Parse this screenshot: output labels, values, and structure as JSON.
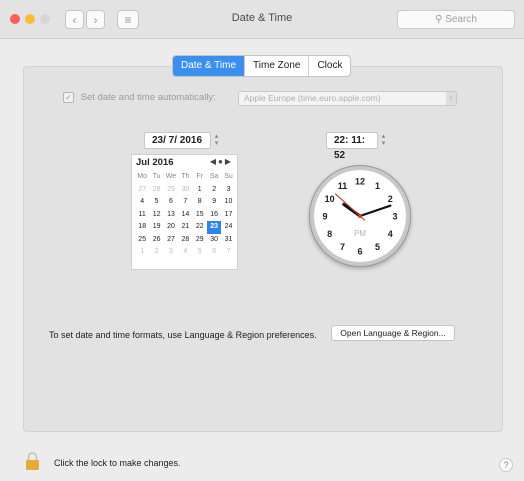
{
  "window": {
    "title": "Date & Time"
  },
  "toolbar": {
    "back_icon": "‹",
    "forward_icon": "›",
    "grid_icon": "≡",
    "search_placeholder": "Search"
  },
  "tabs": [
    {
      "label": "Date & Time",
      "active": true
    },
    {
      "label": "Time Zone",
      "active": false
    },
    {
      "label": "Clock",
      "active": false
    }
  ],
  "auto": {
    "label": "Set date and time automatically:",
    "checked": true,
    "server": "Apple Europe (time.euro.apple.com)"
  },
  "date_field": "23/ 7/ 2016",
  "time_field": "22: 11: 52",
  "calendar": {
    "month_label": "Jul 2016",
    "weekdays": [
      "Mo",
      "Tu",
      "We",
      "Th",
      "Fr",
      "Sa",
      "Su"
    ],
    "days": [
      {
        "d": "27",
        "m": "prev"
      },
      {
        "d": "28",
        "m": "prev"
      },
      {
        "d": "29",
        "m": "prev"
      },
      {
        "d": "30",
        "m": "prev"
      },
      {
        "d": "1",
        "m": "cur"
      },
      {
        "d": "2",
        "m": "cur"
      },
      {
        "d": "3",
        "m": "cur"
      },
      {
        "d": "4",
        "m": "cur"
      },
      {
        "d": "5",
        "m": "cur"
      },
      {
        "d": "6",
        "m": "cur"
      },
      {
        "d": "7",
        "m": "cur"
      },
      {
        "d": "8",
        "m": "cur"
      },
      {
        "d": "9",
        "m": "cur"
      },
      {
        "d": "10",
        "m": "cur"
      },
      {
        "d": "11",
        "m": "cur"
      },
      {
        "d": "12",
        "m": "cur"
      },
      {
        "d": "13",
        "m": "cur"
      },
      {
        "d": "14",
        "m": "cur"
      },
      {
        "d": "15",
        "m": "cur"
      },
      {
        "d": "16",
        "m": "cur"
      },
      {
        "d": "17",
        "m": "cur"
      },
      {
        "d": "18",
        "m": "cur"
      },
      {
        "d": "19",
        "m": "cur"
      },
      {
        "d": "20",
        "m": "cur"
      },
      {
        "d": "21",
        "m": "cur"
      },
      {
        "d": "22",
        "m": "cur"
      },
      {
        "d": "23",
        "m": "sel"
      },
      {
        "d": "24",
        "m": "cur"
      },
      {
        "d": "25",
        "m": "cur"
      },
      {
        "d": "26",
        "m": "cur"
      },
      {
        "d": "27",
        "m": "cur"
      },
      {
        "d": "28",
        "m": "cur"
      },
      {
        "d": "29",
        "m": "cur"
      },
      {
        "d": "30",
        "m": "cur"
      },
      {
        "d": "31",
        "m": "cur"
      },
      {
        "d": "1",
        "m": "next"
      },
      {
        "d": "2",
        "m": "next"
      },
      {
        "d": "3",
        "m": "next"
      },
      {
        "d": "4",
        "m": "next"
      },
      {
        "d": "5",
        "m": "next"
      },
      {
        "d": "6",
        "m": "next"
      },
      {
        "d": "7",
        "m": "next"
      }
    ]
  },
  "clock": {
    "numbers": [
      "12",
      "1",
      "2",
      "3",
      "4",
      "5",
      "6",
      "7",
      "8",
      "9",
      "10",
      "11"
    ],
    "meridiem": "PM",
    "hours": 22,
    "minutes": 11,
    "seconds": 52
  },
  "region_hint": "To set date and time formats, use Language & Region preferences.",
  "open_region_button": "Open Language & Region...",
  "lock_text": "Click the lock to make changes.",
  "help_label": "?",
  "colors": {
    "close": "#fd5f57",
    "minimize": "#fdbc2e",
    "zoom": "#d6d6d6",
    "accent": "#3b8ff0",
    "second_hand": "#c0392b",
    "lock": "#e9a93a"
  }
}
